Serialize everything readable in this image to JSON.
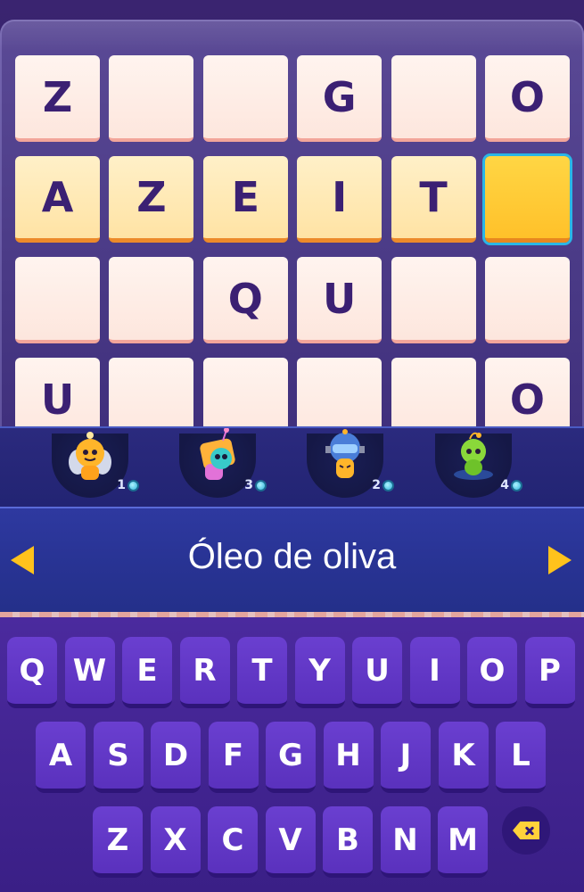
{
  "board": {
    "rows": [
      [
        "Z",
        "",
        "",
        "G",
        "",
        "O"
      ],
      [
        "A",
        "Z",
        "E",
        "I",
        "T",
        ""
      ],
      [
        "",
        "",
        "Q",
        "U",
        "",
        ""
      ],
      [
        "U",
        "",
        "",
        "",
        "",
        "O"
      ]
    ],
    "active_row": 1,
    "cursor": {
      "row": 1,
      "col": 5
    }
  },
  "powerups": [
    {
      "name": "bee-hint",
      "count": "1"
    },
    {
      "name": "tv-hint",
      "count": "3"
    },
    {
      "name": "robot-hint",
      "count": "2"
    },
    {
      "name": "alien-hint",
      "count": "4"
    }
  ],
  "clue": {
    "text": "Óleo de oliva"
  },
  "keyboard": {
    "row1": [
      "Q",
      "W",
      "E",
      "R",
      "T",
      "Y",
      "U",
      "I",
      "O",
      "P"
    ],
    "row2": [
      "A",
      "S",
      "D",
      "F",
      "G",
      "H",
      "J",
      "K",
      "L"
    ],
    "row3": [
      "Z",
      "X",
      "C",
      "V",
      "B",
      "N",
      "M"
    ],
    "backspace_icon": "backspace-icon"
  },
  "colors": {
    "cursor_cell": "#ffc12a",
    "active_cell": "#ffe3a4",
    "accent_arrow": "#ffc21c",
    "key": "#5a31bd"
  }
}
